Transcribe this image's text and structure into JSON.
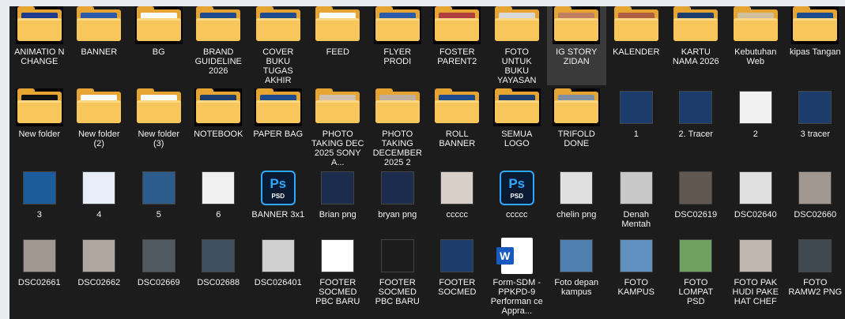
{
  "files": [
    {
      "label": "ANIMATIO N CHANGE",
      "kind": "folder",
      "preview": "#1e3a8a",
      "dark": true
    },
    {
      "label": "BANNER",
      "kind": "folder",
      "preview": "#2a5aa8"
    },
    {
      "label": "BG",
      "kind": "folder",
      "preview": "#ffffff",
      "dark": true
    },
    {
      "label": "BRAND GUIDELINE 2026",
      "kind": "folder",
      "preview": "#1c4c8c"
    },
    {
      "label": "COVER BUKU TUGAS AKHIR",
      "kind": "folder",
      "preview": "#1c4c8c"
    },
    {
      "label": "FEED",
      "kind": "folder",
      "preview": "#ffffff"
    },
    {
      "label": "FLYER PRODI",
      "kind": "folder",
      "preview": "#2a5aa8",
      "dark": true
    },
    {
      "label": "FOSTER PARENT2",
      "kind": "folder",
      "preview": "#b04040",
      "dark": true
    },
    {
      "label": "FOTO UNTUK BUKU YAYASAN",
      "kind": "folder",
      "preview": "#d8d8d8"
    },
    {
      "label": "IG STORY ZIDAN",
      "kind": "folder",
      "preview": "#c08060",
      "dark": true,
      "selected": true
    },
    {
      "label": "KALENDER",
      "kind": "folder",
      "preview": "#b06040"
    },
    {
      "label": "KARTU NAMA 2026",
      "kind": "folder",
      "preview": "#1c3c6c"
    },
    {
      "label": "Kebutuhan Web",
      "kind": "folder",
      "preview": "#d0c0a0"
    },
    {
      "label": "kipas Tangan",
      "kind": "folder",
      "preview": "#1c4c8c",
      "dark": true
    },
    {
      "label": "New folder",
      "kind": "folder",
      "preview": "#111111",
      "dark": true
    },
    {
      "label": "New folder (2)",
      "kind": "folder",
      "preview": "#ffffff"
    },
    {
      "label": "New folder (3)",
      "kind": "folder",
      "preview": "#ffffff"
    },
    {
      "label": "NOTEBOOK",
      "kind": "folder",
      "preview": "#1c3c6c",
      "dark": true
    },
    {
      "label": "PAPER BAG",
      "kind": "folder",
      "preview": "#1c4c8c",
      "dark": true
    },
    {
      "label": "PHOTO TAKING DEC 2025 SONY A...",
      "kind": "folder",
      "preview": "#d0c0b0"
    },
    {
      "label": "PHOTO TAKING DECEMBER 2025 2",
      "kind": "folder",
      "preview": "#c0b0a0"
    },
    {
      "label": "ROLL BANNER",
      "kind": "folder",
      "preview": "#1c4c8c"
    },
    {
      "label": "SEMUA LOGO",
      "kind": "folder",
      "preview": "#1c3c6c",
      "dark": true
    },
    {
      "label": "TRIFOLD DONE",
      "kind": "folder",
      "preview": "#8090a0",
      "dark": true
    },
    {
      "label": "1",
      "kind": "image",
      "preview": "#1c3c6c"
    },
    {
      "label": "2. Tracer",
      "kind": "image",
      "preview": "#1c3c6c"
    },
    {
      "label": "2",
      "kind": "image",
      "preview": "#f0f0f0"
    },
    {
      "label": "3 tracer",
      "kind": "image",
      "preview": "#1c3c6c"
    },
    {
      "label": "3",
      "kind": "image",
      "preview": "#1c5c9c"
    },
    {
      "label": "4",
      "kind": "image",
      "preview": "#e8eef8"
    },
    {
      "label": "5",
      "kind": "image",
      "preview": "#2c5c8c"
    },
    {
      "label": "6",
      "kind": "image",
      "preview": "#f0f0f0"
    },
    {
      "label": "BANNER 3x1",
      "kind": "psd",
      "preview": "#0a1a33"
    },
    {
      "label": "Brian png",
      "kind": "image",
      "preview": "#1c2c4c"
    },
    {
      "label": "bryan png",
      "kind": "image",
      "preview": "#1c2c4c"
    },
    {
      "label": "ccccc",
      "kind": "image",
      "preview": "#d8d0c8"
    },
    {
      "label": "ccccc",
      "kind": "psd",
      "preview": "#0a1a33"
    },
    {
      "label": "chelin png",
      "kind": "image",
      "preview": "#e0e0e0"
    },
    {
      "label": "Denah Mentah",
      "kind": "image",
      "preview": "#c8c8c8"
    },
    {
      "label": "DSC02619",
      "kind": "image",
      "preview": "#605850"
    },
    {
      "label": "DSC02640",
      "kind": "image",
      "preview": "#e0e0e0"
    },
    {
      "label": "DSC02660",
      "kind": "image",
      "preview": "#a09890"
    },
    {
      "label": "DSC02661",
      "kind": "image",
      "preview": "#a09890"
    },
    {
      "label": "DSC02662",
      "kind": "image",
      "preview": "#b0a8a0"
    },
    {
      "label": "DSC02669",
      "kind": "image",
      "preview": "#505860"
    },
    {
      "label": "DSC02688",
      "kind": "image",
      "preview": "#405060"
    },
    {
      "label": "DSC026401",
      "kind": "image",
      "preview": "#d0d0d0"
    },
    {
      "label": "FOOTER SOCMED PBC BARU",
      "kind": "image",
      "preview": "#ffffff"
    },
    {
      "label": "FOOTER SOCMED PBC BARU",
      "kind": "image",
      "preview": "#1c1c1c"
    },
    {
      "label": "FOOTER SOCMED",
      "kind": "image",
      "preview": "#1c3c6c"
    },
    {
      "label": "Form-SDM -PPKPD-9 Performan ce Appra...",
      "kind": "word",
      "preview": "#ffffff"
    },
    {
      "label": "Foto depan kampus",
      "kind": "image",
      "preview": "#5080b0"
    },
    {
      "label": "FOTO KAMPUS",
      "kind": "image",
      "preview": "#6090c0"
    },
    {
      "label": "FOTO LOMPAT PSD",
      "kind": "image",
      "preview": "#70a060"
    },
    {
      "label": "FOTO PAK HUDI PAKE HAT CHEF",
      "kind": "image",
      "preview": "#c0b8b0"
    },
    {
      "label": "FOTO RAMW2 PNG",
      "kind": "image",
      "preview": "#404850"
    }
  ],
  "psd_text": {
    "brand": "Ps",
    "ext": "PSD"
  },
  "word_text": {
    "brand": "W"
  }
}
